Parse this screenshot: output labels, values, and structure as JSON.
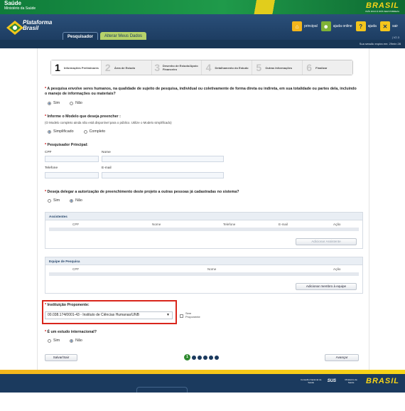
{
  "gov_bar": {
    "ministry_name": "Saúde",
    "ministry_sub": "Ministério da Saúde",
    "brasil": "BRASIL",
    "brasil_tagline": "PAÍS RICO É PAÍS SEM POBREZA"
  },
  "header": {
    "app_name_line1": "Plataforma",
    "app_name_line2": "Brasil",
    "tabs": [
      {
        "label": "Pesquisador"
      },
      {
        "label": "Alterar Meus Dados"
      }
    ],
    "actions": [
      {
        "label": "principal"
      },
      {
        "label": "ajuda online"
      },
      {
        "label": "ajuda"
      },
      {
        "label": "sair"
      }
    ],
    "version": "| V2.3",
    "session": "Sua sessão expira em: 29min 28"
  },
  "wizard": {
    "steps": [
      {
        "num": "1",
        "label": "Informações Preliminares"
      },
      {
        "num": "2",
        "label": "Área de Estudo"
      },
      {
        "num": "3",
        "label": "Desenho de Estudo/Apoio Financeiro"
      },
      {
        "num": "4",
        "label": "Detalhamento do Estudo"
      },
      {
        "num": "5",
        "label": "Outras Informações"
      },
      {
        "num": "6",
        "label": "Finalizar"
      }
    ]
  },
  "form": {
    "q1": {
      "text": "A pesquisa envolve seres humanos, na qualidade de sujeito de pesquisa, individual ou coletivamente de forma direta ou indireta, em sua totalidade ou partes dela, incluindo o manejo de informações ou materiais?",
      "opt_yes": "Sim",
      "opt_no": "Não"
    },
    "q2": {
      "text": "Informe o Modelo que deseja preencher :",
      "note": "(O Modelo completo ainda não está disponível para o público. Utilize o Modelo simplificado)",
      "opt_a": "Simplificado",
      "opt_b": "Completo"
    },
    "researcher": {
      "title": "Pesquisador Principal:",
      "cpf": "CPF",
      "name": "Nome",
      "phone": "Telefone",
      "email": "E-mail"
    },
    "q3": {
      "text": "Deseja delegar a autorização de preenchimento deste projeto a outras pessoas já cadastradas no sistema?",
      "opt_yes": "Sim",
      "opt_no": "Não"
    },
    "assistants": {
      "title": "Assistentes",
      "cols": [
        "CPF",
        "Nome",
        "Telefone",
        "E-mail",
        "Ação"
      ],
      "add": "Adicionar Assistente"
    },
    "team": {
      "title": "Equipe de Pesquisa",
      "cols": [
        "CPF",
        "Nome",
        "Ação"
      ],
      "add": "Adicionar membro à equipe"
    },
    "institution": {
      "title": "Instituição Proponente:",
      "value": "00.038.174/0001-43 - Instituto de Ciências Humanas/UNB",
      "without": "Sem Proponente"
    },
    "q4": {
      "text": "É um estudo internacional?",
      "opt_yes": "Sim",
      "opt_no": "Não"
    },
    "save_exit": "Salvar/Sair",
    "next": "Avançar",
    "page": "1"
  },
  "footer": {
    "conselho": "Conselho Nacional de Saúde",
    "sus": "SUS",
    "ministerio": "Ministério da Saúde",
    "brasil": "BRASIL"
  }
}
